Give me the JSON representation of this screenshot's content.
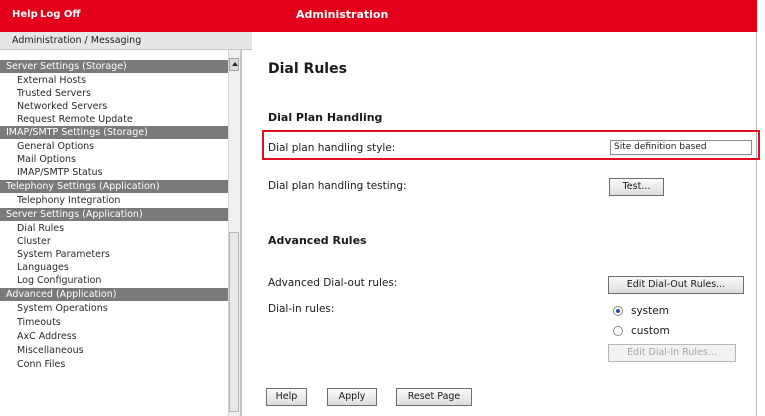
{
  "topbar": {
    "help": "Help",
    "logoff": "Log Off",
    "title": "Administration"
  },
  "breadcrumb": "Administration / Messaging",
  "sidebar": {
    "sections": [
      {
        "title": "Server Settings (Storage)",
        "items": [
          "External Hosts",
          "Trusted Servers",
          "Networked Servers",
          "Request Remote Update"
        ]
      },
      {
        "title": "IMAP/SMTP Settings (Storage)",
        "items": [
          "General Options",
          "Mail Options",
          "IMAP/SMTP Status"
        ]
      },
      {
        "title": "Telephony Settings (Application)",
        "items": [
          "Telephony Integration"
        ]
      },
      {
        "title": "Server Settings (Application)",
        "items": [
          "Dial Rules",
          "Cluster",
          "System Parameters",
          "Languages",
          "Log Configuration"
        ]
      },
      {
        "title": "Advanced (Application)",
        "items": [
          "System Operations",
          "Timeouts",
          "AxC Address",
          "Miscellaneous",
          "Conn Files"
        ]
      }
    ]
  },
  "main": {
    "title": "Dial Rules",
    "dial_plan": {
      "heading": "Dial Plan Handling",
      "style_label": "Dial plan handling style:",
      "style_value": "Site definition based",
      "testing_label": "Dial plan handling testing:",
      "test_button": "Test..."
    },
    "advanced": {
      "heading": "Advanced Rules",
      "dialout_label": "Advanced Dial-out rules:",
      "dialout_button": "Edit Dial-Out Rules...",
      "dialin_label": "Dial-in rules:",
      "radio_system": "system",
      "radio_custom": "custom",
      "selected": "system",
      "dialin_button": "Edit Dial-In Rules..."
    },
    "footer": {
      "help": "Help",
      "apply": "Apply",
      "reset": "Reset Page"
    }
  },
  "colors": {
    "brand_red": "#e4001a",
    "section_gray": "#7a7a7a",
    "highlight_red": "#e0101e"
  }
}
